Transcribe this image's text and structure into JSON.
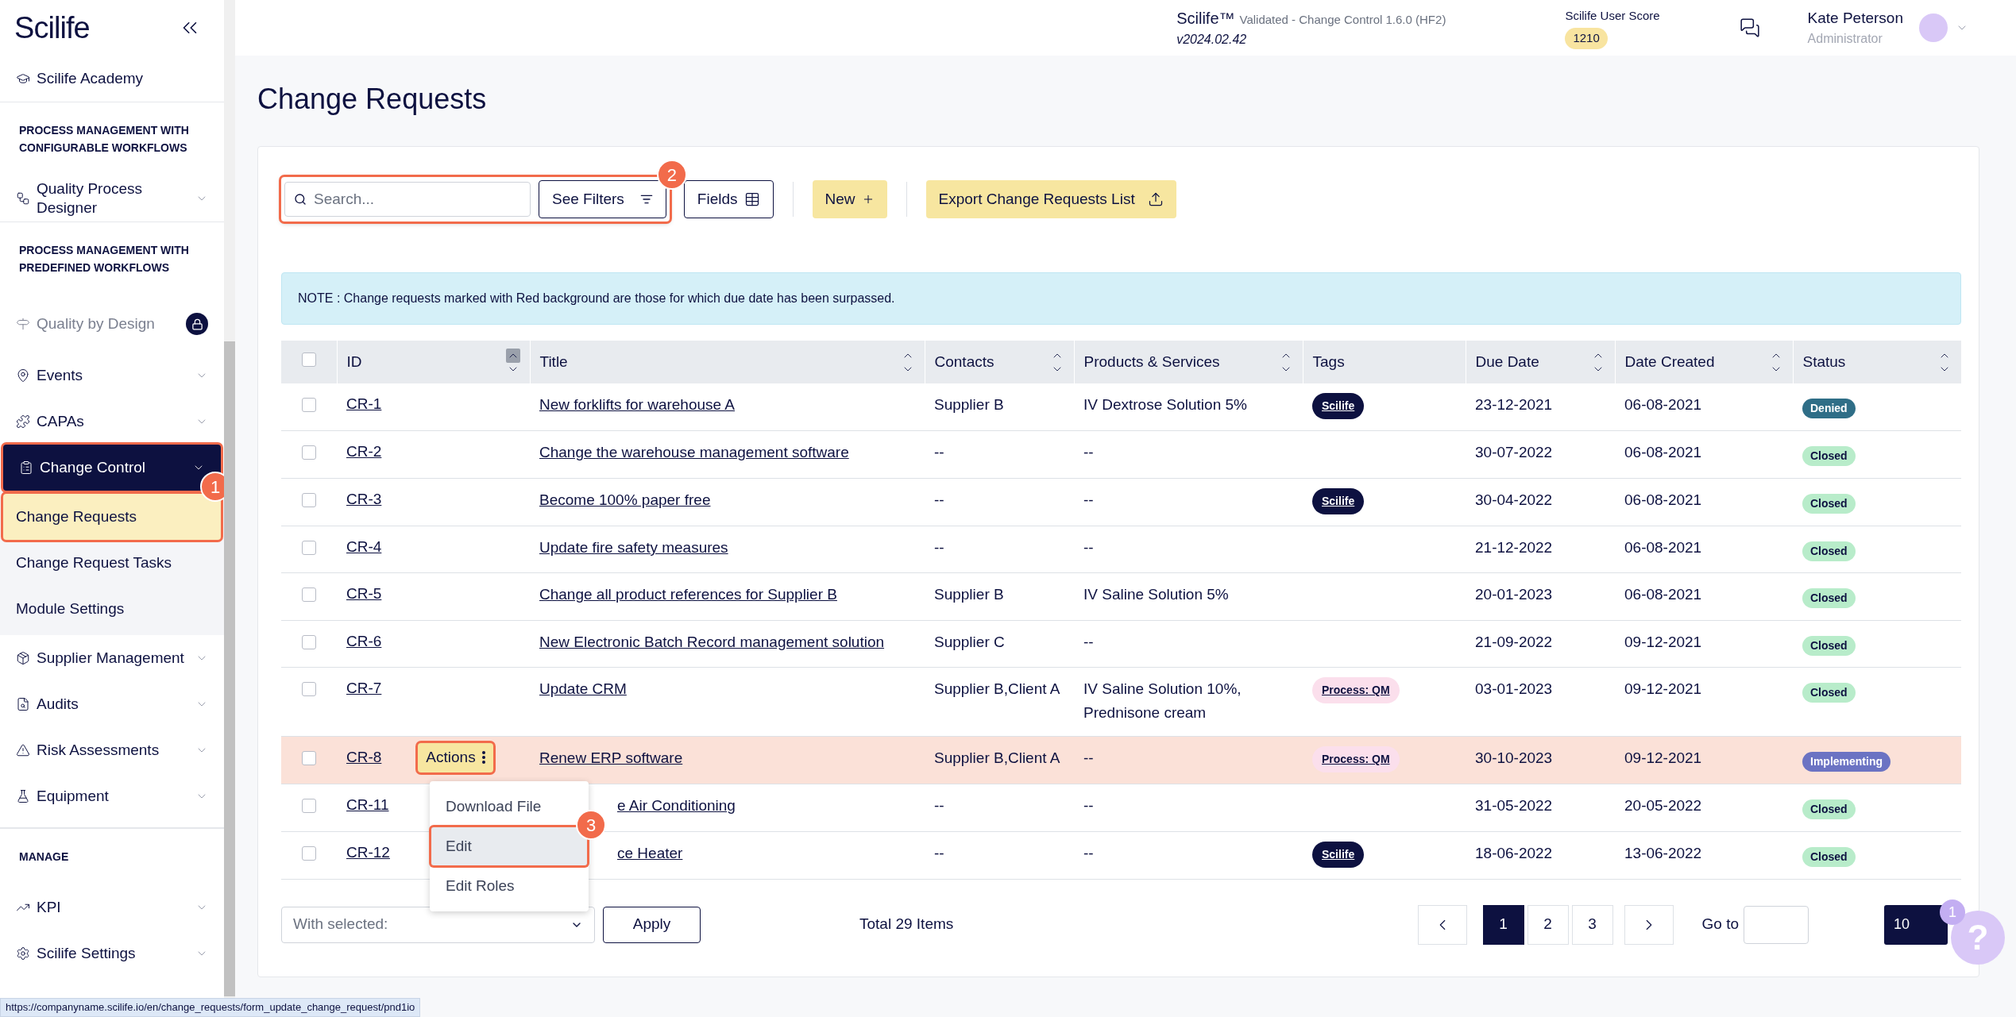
{
  "sidebar": {
    "logo": "Scilife",
    "entries": [
      {
        "kind": "item",
        "label": "Scilife Academy",
        "chevron": false
      },
      {
        "kind": "section",
        "label": "PROCESS MANAGEMENT WITH CONFIGURABLE WORKFLOWS"
      },
      {
        "kind": "item",
        "label": "Quality Process Designer",
        "chevron": true
      },
      {
        "kind": "section",
        "label": "PROCESS MANAGEMENT WITH PREDEFINED WORKFLOWS"
      },
      {
        "kind": "item",
        "label": "Quality by Design",
        "locked": true
      },
      {
        "kind": "item",
        "label": "Events",
        "chevron": true
      },
      {
        "kind": "item",
        "label": "CAPAs",
        "chevron": true
      },
      {
        "kind": "item",
        "label": "Change Control",
        "chevron": true,
        "expanded": true,
        "outlined": true,
        "children": [
          {
            "label": "Change Requests",
            "selected": true,
            "outlined": true,
            "callout": "1"
          },
          {
            "label": "Change Request Tasks",
            "selected": false
          },
          {
            "label": "Module Settings",
            "selected": false
          }
        ]
      },
      {
        "kind": "item",
        "label": "Supplier Management",
        "chevron": true
      },
      {
        "kind": "item",
        "label": "Audits",
        "chevron": true
      },
      {
        "kind": "item",
        "label": "Risk Assessments",
        "chevron": true
      },
      {
        "kind": "item",
        "label": "Equipment",
        "chevron": true
      },
      {
        "kind": "section",
        "label": "MANAGE"
      },
      {
        "kind": "item",
        "label": "KPI",
        "chevron": true
      },
      {
        "kind": "item",
        "label": "Scilife Settings",
        "chevron": true
      }
    ]
  },
  "header": {
    "product": "Scilife™",
    "release": "Validated - Change Control 1.6.0 (HF2)",
    "version": "v2024.02.42",
    "score_label": "Scilife User Score",
    "score": "1210",
    "user_name": "Kate Peterson",
    "user_role": "Administrator"
  },
  "page_title": "Change Requests",
  "toolbar": {
    "search": {
      "placeholder": "Search..."
    },
    "filters": "See Filters",
    "outlined": true,
    "callout": "2",
    "fields": "Fields",
    "new": "New",
    "export": "Export Change Requests List"
  },
  "note": "NOTE : Change requests marked with Red background are those for which due date has been surpassed.",
  "table": {
    "select_all": {
      "checked": false
    },
    "columns": [
      {
        "label": "ID",
        "sortable": true,
        "sorted": true
      },
      {
        "label": "Title",
        "sortable": true,
        "sorted": false
      },
      {
        "label": "Contacts",
        "sortable": true,
        "sorted": false
      },
      {
        "label": "Products & Services",
        "sortable": true,
        "sorted": false
      },
      {
        "label": "Tags",
        "sortable": false
      },
      {
        "label": "Due Date",
        "sortable": true,
        "sorted": false
      },
      {
        "label": "Date Created",
        "sortable": true,
        "sorted": false
      },
      {
        "label": "Status",
        "sortable": true,
        "sorted": false
      }
    ],
    "rows": [
      {
        "checked": false,
        "overdue": false,
        "id": "CR-1",
        "title": "New forklifts for warehouse A",
        "contacts": "Supplier B",
        "products": "IV Dextrose Solution 5%",
        "tags": [
          {
            "label": "Scilife",
            "color": "#0d1140"
          }
        ],
        "due": "23-12-2021",
        "created": "06-08-2021",
        "status": {
          "label": "Denied",
          "color": "#2f6e87"
        }
      },
      {
        "checked": false,
        "overdue": false,
        "id": "CR-2",
        "title": "Change the warehouse management software",
        "contacts": "--",
        "products": "--",
        "due": "30-07-2022",
        "created": "06-08-2021",
        "status": {
          "label": "Closed",
          "color": "#b8ecca"
        }
      },
      {
        "checked": false,
        "overdue": false,
        "id": "CR-3",
        "title": "Become 100% paper free",
        "contacts": "--",
        "products": "--",
        "tags": [
          {
            "label": "Scilife",
            "color": "#0d1140"
          }
        ],
        "due": "30-04-2022",
        "created": "06-08-2021",
        "status": {
          "label": "Closed",
          "color": "#b8ecca"
        }
      },
      {
        "checked": false,
        "overdue": false,
        "id": "CR-4",
        "title": "Update fire safety measures",
        "contacts": "--",
        "products": "--",
        "due": "21-12-2022",
        "created": "06-08-2021",
        "status": {
          "label": "Closed",
          "color": "#b8ecca"
        }
      },
      {
        "checked": false,
        "overdue": false,
        "id": "CR-5",
        "title": "Change all product references for Supplier B",
        "contacts": "Supplier B",
        "products": "IV Saline Solution 5%",
        "due": "20-01-2023",
        "created": "06-08-2021",
        "status": {
          "label": "Closed",
          "color": "#b8ecca"
        }
      },
      {
        "checked": false,
        "overdue": false,
        "id": "CR-6",
        "title": "New Electronic Batch Record management solution",
        "contacts": "Supplier C",
        "products": "--",
        "due": "21-09-2022",
        "created": "09-12-2021",
        "status": {
          "label": "Closed",
          "color": "#b8ecca"
        }
      },
      {
        "checked": false,
        "overdue": false,
        "id": "CR-7",
        "title": "Update CRM",
        "contacts": "Supplier B,Client A",
        "products": "IV Saline Solution 10%, Prednisone cream",
        "tags": [
          {
            "label": "Process: QM",
            "color": "#fbdfec"
          }
        ],
        "due": "03-01-2023",
        "created": "09-12-2021",
        "status": {
          "label": "Closed",
          "color": "#b8ecca"
        }
      },
      {
        "checked": false,
        "overdue": true,
        "id": "CR-8",
        "title": "Renew ERP software",
        "contacts": "Supplier B,Client A",
        "products": "--",
        "tags": [
          {
            "label": "Process: QM",
            "color": "#fbdfec"
          }
        ],
        "due": "30-10-2023",
        "created": "09-12-2021",
        "status": {
          "label": "Implementing",
          "color": "#6b73c3"
        },
        "actions": {
          "label": "Actions",
          "outlined": true,
          "menu": [
            {
              "label": "Download File",
              "highlighted": false
            },
            {
              "label": "Edit",
              "highlighted": true,
              "outlined": true,
              "callout": "3"
            },
            {
              "label": "Edit Roles",
              "highlighted": false
            }
          ]
        }
      },
      {
        "checked": false,
        "overdue": false,
        "covered": true,
        "id": "CR-11",
        "title": "e Air Conditioning",
        "contacts": "--",
        "products": "--",
        "due": "31-05-2022",
        "created": "20-05-2022",
        "status": {
          "label": "Closed",
          "color": "#b8ecca"
        }
      },
      {
        "checked": false,
        "overdue": false,
        "covered": true,
        "id": "CR-12",
        "title": "ce Heater",
        "contacts": "--",
        "products": "--",
        "tags": [
          {
            "label": "Scilife",
            "color": "#0d1140"
          }
        ],
        "due": "18-06-2022",
        "created": "13-06-2022",
        "status": {
          "label": "Closed",
          "color": "#b8ecca"
        }
      }
    ]
  },
  "footer": {
    "bulk": {
      "placeholder": "With selected:"
    },
    "apply": "Apply",
    "total": "Total 29 Items",
    "pages": [
      {
        "label": "1",
        "selected": true
      },
      {
        "label": "2",
        "selected": false
      },
      {
        "label": "3",
        "selected": false
      }
    ],
    "goto_label": "Go to",
    "page_size": "10"
  },
  "help": {
    "label": "?",
    "badge": "1"
  },
  "status_url": "https://companyname.scilife.io/en/change_requests/form_update_change_request/pnd1io"
}
